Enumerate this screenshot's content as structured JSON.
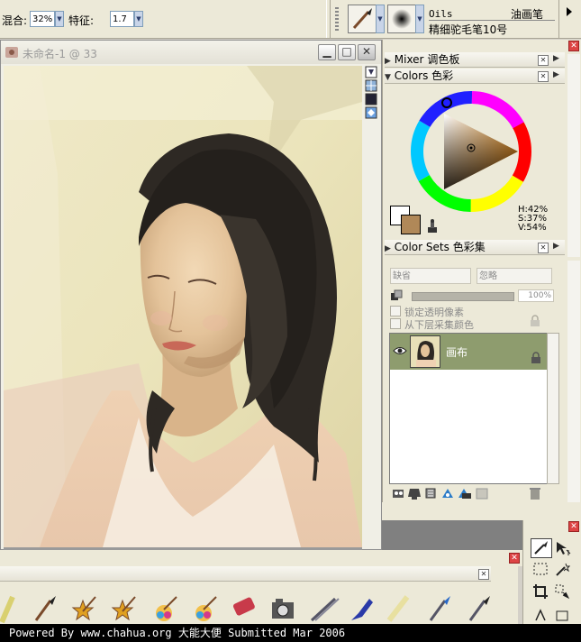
{
  "topbar": {
    "blend_label": "混合:",
    "blend_value": "32%",
    "feature_label": "特征:",
    "feature_value": "1.7",
    "brush_category": "Oils",
    "brush_category_cn": "油画笔",
    "brush_variant": "精细驼毛笔10号"
  },
  "document": {
    "title": "未命名-1 @ 33"
  },
  "panels": {
    "mixer_label": "Mixer",
    "mixer_cn": "调色板",
    "colors_label": "Colors",
    "colors_cn": "色彩",
    "color_sets_label": "Color Sets",
    "color_sets_cn": "色彩集",
    "hsv_h": "H:42%",
    "hsv_s": "S:37%",
    "hsv_v": "V:54%",
    "main_color": "#ffffff",
    "secondary_color": "#b08858"
  },
  "layers": {
    "composite_method": "缺省",
    "composite_depth": "忽略",
    "opacity": "100%",
    "opacity_level": 1.0,
    "lock_transparency": "锁定透明像素",
    "pick_underlying": "从下层采集颜色",
    "items": [
      {
        "name": "画布",
        "visible": true
      }
    ]
  },
  "footer": {
    "text": "Powered By www.chahua.org 大能大便 Submitted Mar 2006"
  },
  "colors": {
    "layer_selected": "#8e9c6e",
    "accent": "#c44"
  }
}
